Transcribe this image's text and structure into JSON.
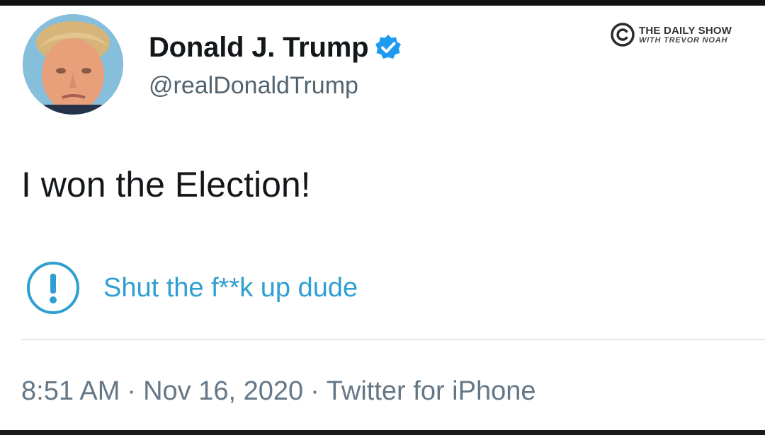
{
  "tweet": {
    "author": {
      "display_name": "Donald J. Trump",
      "handle": "@realDonaldTrump",
      "verified": true
    },
    "text": "I won the Election!",
    "notice": {
      "text": "Shut the f**k up dude",
      "icon": "exclamation-circle-icon"
    },
    "meta": {
      "time": "8:51 AM",
      "separator": "·",
      "date": "Nov 16, 2020",
      "source": "Twitter for iPhone"
    }
  },
  "watermark": {
    "line1": "THE DAILY SHOW",
    "line2": "WITH TREVOR NOAH"
  },
  "colors": {
    "verified_blue": "#1d9bf0",
    "link_blue": "#2f9fd1",
    "text_dark": "#14171a",
    "text_gray": "#657786"
  }
}
